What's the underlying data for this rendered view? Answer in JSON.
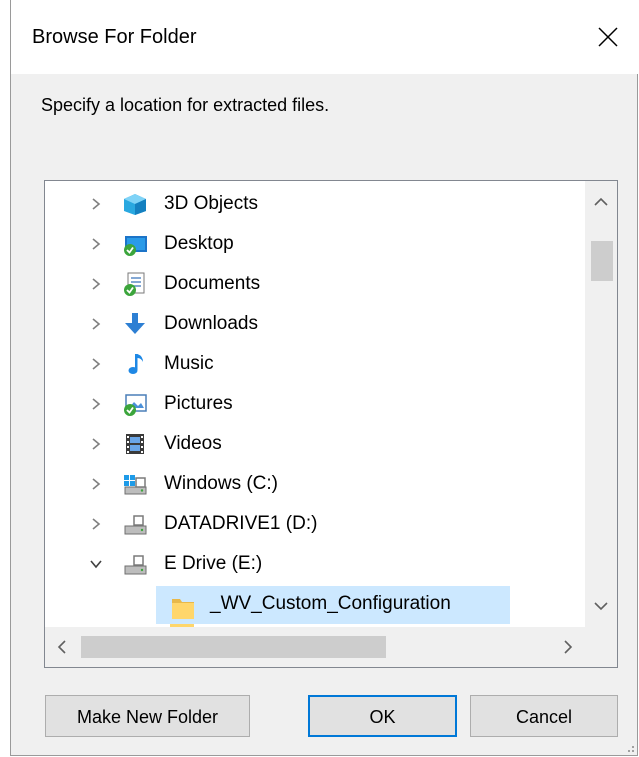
{
  "dialog": {
    "title": "Browse For Folder",
    "prompt": "Specify a location for extracted files."
  },
  "tree": {
    "items": [
      {
        "label": "3D Objects",
        "icon": "3d-objects-icon",
        "state": "collapsed"
      },
      {
        "label": "Desktop",
        "icon": "desktop-icon",
        "state": "collapsed"
      },
      {
        "label": "Documents",
        "icon": "documents-icon",
        "state": "collapsed"
      },
      {
        "label": "Downloads",
        "icon": "downloads-icon",
        "state": "collapsed"
      },
      {
        "label": "Music",
        "icon": "music-icon",
        "state": "collapsed"
      },
      {
        "label": "Pictures",
        "icon": "pictures-icon",
        "state": "collapsed"
      },
      {
        "label": "Videos",
        "icon": "videos-icon",
        "state": "collapsed"
      },
      {
        "label": "Windows  (C:)",
        "icon": "windows-drive-icon",
        "state": "collapsed"
      },
      {
        "label": "DATADRIVE1 (D:)",
        "icon": "drive-icon",
        "state": "collapsed"
      },
      {
        "label": "E Drive (E:)",
        "icon": "drive-icon",
        "state": "expanded"
      },
      {
        "label": "_WV_Custom_Configuration",
        "icon": "folder-icon",
        "state": "selected"
      }
    ]
  },
  "buttons": {
    "make_new_folder": "Make New Folder",
    "ok": "OK",
    "cancel": "Cancel"
  },
  "colors": {
    "selection": "#cce8ff",
    "default_button_border": "#0078d7",
    "dialog_background": "#f0f0f0"
  }
}
